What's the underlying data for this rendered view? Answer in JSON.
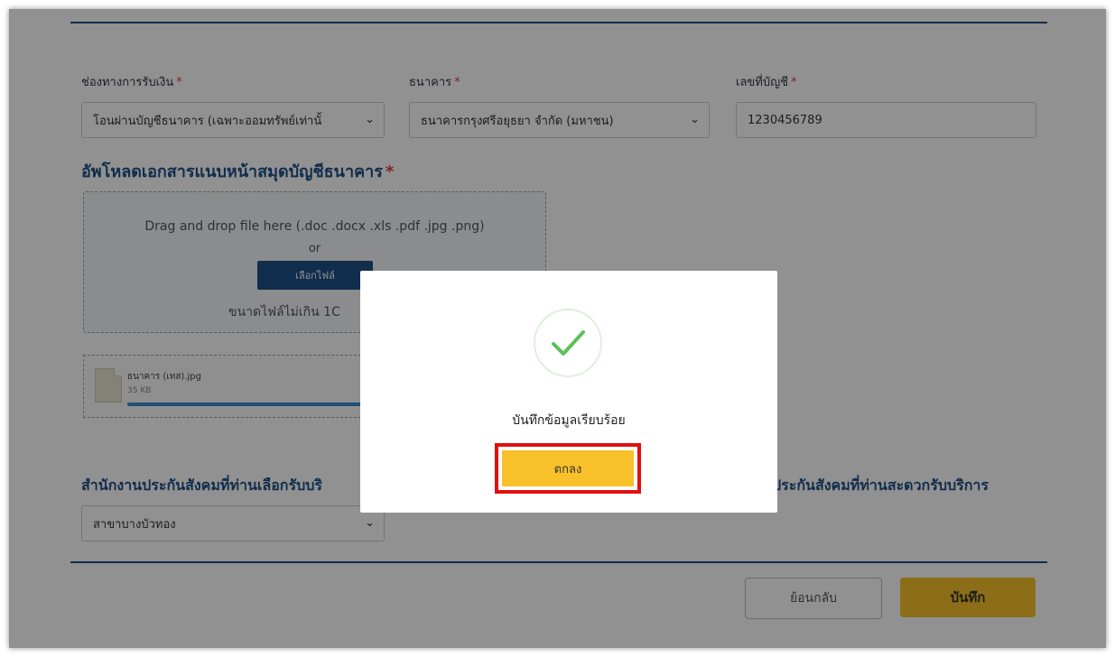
{
  "form": {
    "payment_method": {
      "label": "ช่องทางการรับเงิน",
      "value": "โอนผ่านบัญชีธนาคาร (เฉพาะออมทรัพย์เท่านั้"
    },
    "bank": {
      "label": "ธนาคาร",
      "value": "ธนาคารกรุงศรีอยุธยา จำกัด (มหาชน)"
    },
    "account_no": {
      "label": "เลขที่บัญชี",
      "value": "1230456789"
    },
    "required_mark": "*",
    "upload": {
      "title": "อัพโหลดเอกสารแนบหน้าสมุดบัญชีธนาคาร",
      "drag_text": "Drag and drop file here (.doc .docx .xls .pdf .jpg .png)",
      "or": "or",
      "pick_label": "เลือกไฟล์",
      "size_limit": "ขนาดไฟล์ไม่เกิน 1C"
    },
    "file": {
      "name": "ธนาคาร (เทส).jpg",
      "size": "35 KB",
      "progress": 1.0
    },
    "office_left": {
      "title": "สำนักงานประกันสังคมที่ท่านเลือกรับบริ",
      "value": "สาขาบางบัวทอง"
    },
    "office_right": {
      "title": "ประกันสังคมที่ท่านสะดวกรับบริการ"
    },
    "back_label": "ย้อนกลับ",
    "save_label": "บันทึก"
  },
  "modal": {
    "icon": "check-icon",
    "message": "บันทึกข้อมูลเรียบร้อย",
    "ok_label": "ตกลง"
  },
  "colors": {
    "accent_blue": "#1f4f86",
    "yellow": "#f8c12a",
    "highlight_red": "#e10f0f",
    "check_green": "#5cc15a"
  }
}
